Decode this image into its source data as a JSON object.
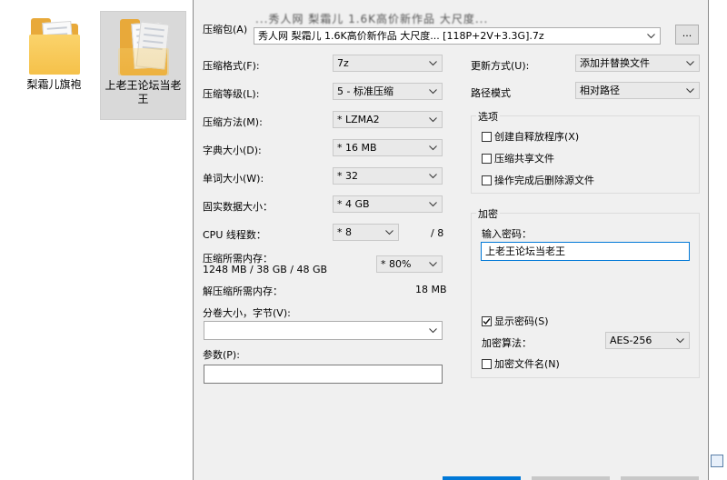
{
  "desktop": {
    "icons": [
      {
        "label": "梨霜儿旗袍"
      },
      {
        "label": "上老王论坛当老王"
      }
    ]
  },
  "dialog": {
    "archive": {
      "label": "压缩包(A)",
      "path_hint": "...秀人网 梨霜儿 1.6K高价新作品 大尺度...",
      "value": "秀人网 梨霜儿 1.6K高价新作品 大尺度... [118P+2V+3.3G].7z",
      "browse_label": "..."
    },
    "format": {
      "label": "压缩格式(F):",
      "value": "7z"
    },
    "level": {
      "label": "压缩等级(L):",
      "value": "5 - 标准压缩"
    },
    "method": {
      "label": "压缩方法(M):",
      "value": "* LZMA2"
    },
    "dict": {
      "label": "字典大小(D):",
      "value": "* 16 MB"
    },
    "word": {
      "label": "单词大小(W):",
      "value": "* 32"
    },
    "solid": {
      "label": "固实数据大小：",
      "value": "* 4 GB"
    },
    "threads": {
      "label": "CPU 线程数：",
      "value": "* 8",
      "total": "/ 8"
    },
    "mem_compress": {
      "label": "压缩所需内存：",
      "detail": "1248 MB / 38 GB / 48 GB",
      "value": "* 80%"
    },
    "mem_decompress": {
      "label": "解压缩所需内存：",
      "value": "18 MB"
    },
    "volume": {
      "label": "分卷大小，字节(V):",
      "value": ""
    },
    "params": {
      "label": "参数(P):",
      "value": ""
    },
    "update": {
      "label": "更新方式(U):",
      "value": "添加并替换文件"
    },
    "pathmode": {
      "label": "路径模式",
      "value": "相对路径"
    },
    "options": {
      "title": "选项",
      "sfx": "创建自释放程序(X)",
      "shared": "压缩共享文件",
      "delete": "操作完成后删除源文件"
    },
    "encryption": {
      "title": "加密",
      "password_label": "输入密码：",
      "password_value": "上老王论坛当老王",
      "show_password": "显示密码(S)",
      "algo_label": "加密算法：",
      "algo_value": "AES-256",
      "encrypt_names": "加密文件名(N)"
    }
  }
}
